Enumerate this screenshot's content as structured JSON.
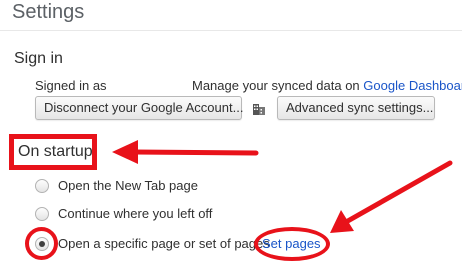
{
  "header": {
    "title": "Settings"
  },
  "sign_in": {
    "title": "Sign in",
    "signed_in_as": "Signed in as",
    "manage_text": "Manage your synced data on",
    "dashboard_link": "Google Dashboard",
    "dashboard_period": ".",
    "disconnect_button": "Disconnect your Google Account...",
    "org_icon": "building-icon",
    "advanced_sync_button": "Advanced sync settings..."
  },
  "startup": {
    "title": "On startup",
    "options": [
      {
        "label": "Open the New Tab page",
        "selected": false
      },
      {
        "label": "Continue where you left off",
        "selected": false
      },
      {
        "label": "Open a specific page or set of pages",
        "selected": true
      }
    ],
    "set_pages_link": "Set pages"
  },
  "annotations": {
    "color": "#e8121a"
  }
}
